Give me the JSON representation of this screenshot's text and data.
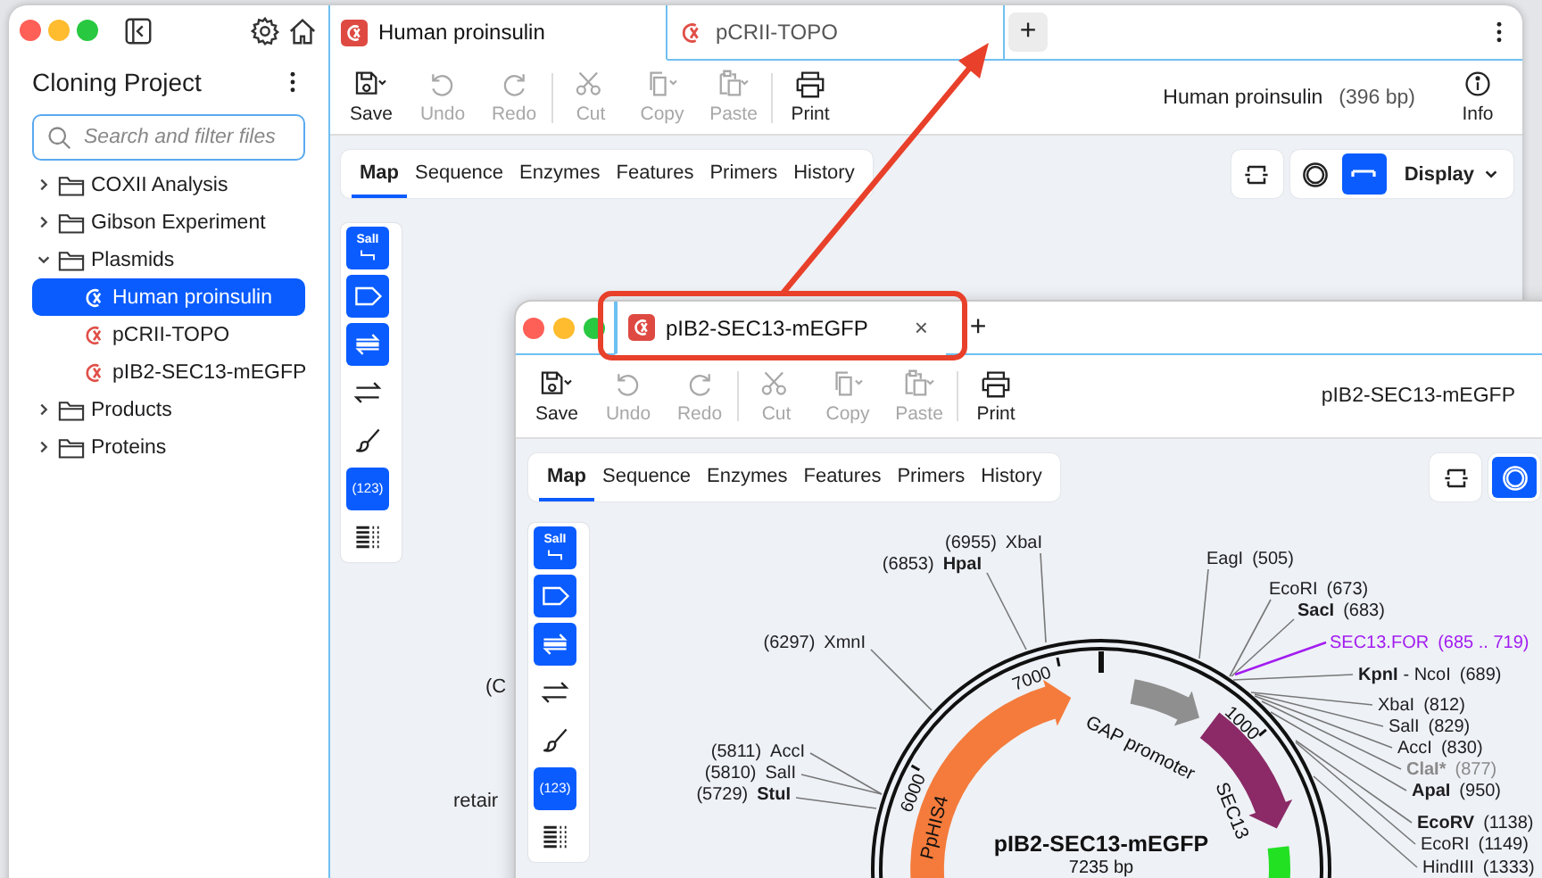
{
  "main_window": {
    "sidebar": {
      "title": "Cloning Project",
      "search": {
        "placeholder": "Search and filter files"
      },
      "tree": [
        {
          "label": "COXII Analysis",
          "kind": "folder",
          "expanded": false
        },
        {
          "label": "Gibson Experiment",
          "kind": "folder",
          "expanded": false
        },
        {
          "label": "Plasmids",
          "kind": "folder",
          "expanded": true,
          "children": [
            {
              "label": "Human proinsulin",
              "kind": "file",
              "selected": true
            },
            {
              "label": "pCRII-TOPO",
              "kind": "file",
              "selected": false
            },
            {
              "label": "pIB2-SEC13-mEGFP",
              "kind": "file",
              "selected": false
            }
          ]
        },
        {
          "label": "Products",
          "kind": "folder",
          "expanded": false
        },
        {
          "label": "Proteins",
          "kind": "folder",
          "expanded": false
        }
      ]
    },
    "tabs": [
      {
        "label": "Human proinsulin",
        "selected": true
      },
      {
        "label": "pCRII-TOPO",
        "selected": false
      }
    ],
    "new_tab": "+",
    "toolbar": [
      [
        {
          "kind": "save",
          "label": "Save",
          "disabled": false
        },
        {
          "kind": "undo",
          "label": "Undo",
          "disabled": true
        },
        {
          "kind": "redo",
          "label": "Redo",
          "disabled": true
        }
      ],
      [
        {
          "kind": "cut",
          "label": "Cut",
          "disabled": true
        },
        {
          "kind": "copy",
          "label": "Copy",
          "disabled": true
        },
        {
          "kind": "paste",
          "label": "Paste",
          "disabled": true
        }
      ],
      [
        {
          "kind": "print",
          "label": "Print",
          "disabled": false
        }
      ]
    ],
    "sequence_name": "Human proinsulin",
    "sequence_length": "(396 bp)",
    "info": "Info",
    "view_tabs": [
      {
        "label": "Map",
        "selected": true
      },
      {
        "label": "Sequence",
        "selected": false
      },
      {
        "label": "Enzymes",
        "selected": false
      },
      {
        "label": "Features",
        "selected": false
      },
      {
        "label": "Primers",
        "selected": false
      },
      {
        "label": "History",
        "selected": false
      }
    ],
    "view_buttons": [
      {
        "kind": "linear",
        "selected": false
      },
      {
        "kind": "circular",
        "selected": false
      },
      {
        "kind": "bar",
        "selected": true
      }
    ],
    "display": "Display",
    "tools": [
      {
        "kind": "enzymes",
        "label": "SalI",
        "on": true
      },
      {
        "kind": "features",
        "on": true
      },
      {
        "kind": "primers",
        "on": true
      },
      {
        "kind": "strands",
        "on": false
      },
      {
        "kind": "colors",
        "on": false
      },
      {
        "kind": "numbers",
        "label": "(123)",
        "on": true
      },
      {
        "kind": "sequence",
        "on": false
      }
    ],
    "map_fragments": [
      "(C",
      "retair"
    ]
  },
  "second_window": {
    "tabs": [
      {
        "label": "pIB2-SEC13-mEGFP",
        "selected": true,
        "close": "×"
      }
    ],
    "new_tab": "+",
    "toolbar": [
      [
        {
          "kind": "save",
          "label": "Save",
          "disabled": false
        },
        {
          "kind": "undo",
          "label": "Undo",
          "disabled": true
        },
        {
          "kind": "redo",
          "label": "Redo",
          "disabled": true
        }
      ],
      [
        {
          "kind": "cut",
          "label": "Cut",
          "disabled": true
        },
        {
          "kind": "copy",
          "label": "Copy",
          "disabled": true
        },
        {
          "kind": "paste",
          "label": "Paste",
          "disabled": true
        }
      ],
      [
        {
          "kind": "print",
          "label": "Print",
          "disabled": false
        }
      ]
    ],
    "sequence_name": "pIB2-SEC13-mEGFP",
    "view_tabs": [
      {
        "label": "Map",
        "selected": true
      },
      {
        "label": "Sequence",
        "selected": false
      },
      {
        "label": "Enzymes",
        "selected": false
      },
      {
        "label": "Features",
        "selected": false
      },
      {
        "label": "Primers",
        "selected": false
      },
      {
        "label": "History",
        "selected": false
      }
    ],
    "view_buttons": [
      {
        "kind": "linear",
        "selected": false
      },
      {
        "kind": "circular",
        "selected": true
      }
    ],
    "tools": [
      {
        "kind": "enzymes",
        "label": "SalI",
        "on": true
      },
      {
        "kind": "features",
        "on": true
      },
      {
        "kind": "primers",
        "on": true
      },
      {
        "kind": "strands",
        "on": false
      },
      {
        "kind": "colors",
        "on": false
      },
      {
        "kind": "numbers",
        "label": "(123)",
        "on": true
      },
      {
        "kind": "sequence",
        "on": false
      }
    ],
    "map": {
      "title": "pIB2-SEC13-mEGFP",
      "length": "7235 bp",
      "ticks": [
        "7000",
        "1000",
        "6000"
      ],
      "features": [
        {
          "label": "PpHIS4",
          "color": "#f47b3b"
        },
        {
          "label": "GAP promoter",
          "color": "#8f8f8f"
        },
        {
          "label": "SEC13",
          "color": "#8b2a67"
        },
        {
          "color": "#22e022"
        }
      ],
      "sites": [
        {
          "position": "(6955)",
          "name": "XbaI",
          "bold": false,
          "kind": "enzyme"
        },
        {
          "position": "(6853)",
          "name": "HpaI",
          "bold": true,
          "kind": "enzyme"
        },
        {
          "position": "(6297)",
          "name": "XmnI",
          "bold": false,
          "kind": "enzyme"
        },
        {
          "position": "(5811)",
          "name": "AccI",
          "bold": false,
          "kind": "enzyme"
        },
        {
          "position": "(5810)",
          "name": "SalI",
          "bold": false,
          "kind": "enzyme"
        },
        {
          "position": "(5729)",
          "name": "StuI",
          "bold": true,
          "kind": "enzyme"
        },
        {
          "position": "(505)",
          "name": "EagI",
          "bold": false,
          "kind": "enzyme"
        },
        {
          "position": "(673)",
          "name": "EcoRI",
          "bold": false,
          "kind": "enzyme"
        },
        {
          "position": "(683)",
          "name": "SacI",
          "bold": true,
          "kind": "enzyme"
        },
        {
          "position": "(685 .. 719)",
          "name": "SEC13.FOR",
          "bold": false,
          "kind": "primer"
        },
        {
          "position": "(689)",
          "name": "KpnI",
          "alias": "- NcoI",
          "bold": true,
          "kind": "enzyme"
        },
        {
          "position": "(812)",
          "name": "XbaI",
          "bold": false,
          "kind": "enzyme"
        },
        {
          "position": "(829)",
          "name": "SalI",
          "bold": false,
          "kind": "enzyme"
        },
        {
          "position": "(830)",
          "name": "AccI",
          "bold": false,
          "kind": "enzyme"
        },
        {
          "position": "(877)",
          "name": "ClaI*",
          "bold": true,
          "kind": "blocked"
        },
        {
          "position": "(950)",
          "name": "ApaI",
          "bold": true,
          "kind": "enzyme"
        },
        {
          "position": "(1138)",
          "name": "EcoRV",
          "bold": true,
          "kind": "enzyme"
        },
        {
          "position": "(1149)",
          "name": "EcoRI",
          "bold": false,
          "kind": "enzyme"
        },
        {
          "position": "(1333)",
          "name": "HindIII",
          "bold": false,
          "kind": "enzyme"
        }
      ]
    }
  }
}
